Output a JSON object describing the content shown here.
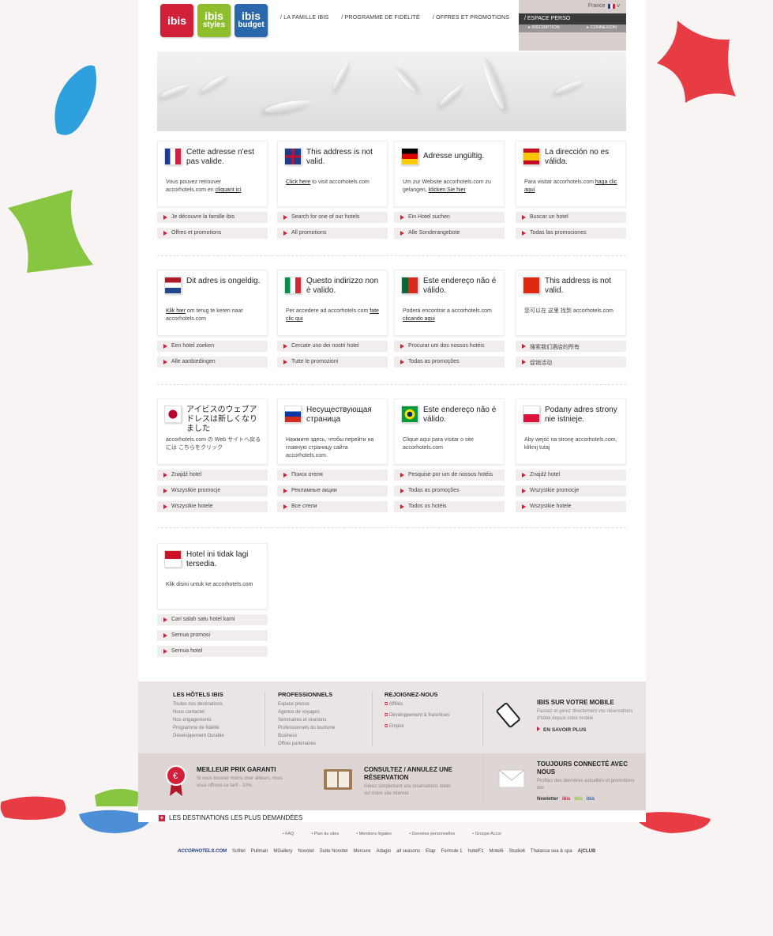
{
  "header": {
    "logos": [
      {
        "name": "ibis",
        "sub": "",
        "color": "#d3203a"
      },
      {
        "name": "ibis",
        "sub": "styles",
        "color": "#8fbe2d"
      },
      {
        "name": "ibis",
        "sub": "budget",
        "color": "#2a67ad"
      }
    ],
    "nav": [
      "/ LA FAMILLE IBIS",
      "/ PROGRAMME DE FIDÉLITÉ",
      "/ OFFRES ET PROMOTIONS"
    ],
    "lang": "France",
    "espace": "/ ESPACE PERSO",
    "inscription": "INSCRIPTION",
    "connexion": "CONNEXION"
  },
  "cards": [
    {
      "title": "Cette adresse n'est pas valide.",
      "msg": "Vous pouvez retrouver accorhotels.com en ",
      "msg_link": "cliquant ici",
      "links": [
        "Je découvre la famille ibis",
        "Offres et promotions"
      ],
      "flag": "fr"
    },
    {
      "title": "This address is not valid.",
      "msg_link_first": "Click here",
      "msg": " to visit accorhotels.com",
      "links": [
        "Search for one of our hotels",
        "All promotions"
      ],
      "flag": "uk"
    },
    {
      "title": "Adresse ungültig.",
      "msg": "Um zur Website accorhotels.com zu gelangen, ",
      "msg_link": "klicken Sie hier",
      "links": [
        "Ein Hotel suchen",
        "Alle Sonderangebote"
      ],
      "flag": "de"
    },
    {
      "title": "La dirección no es válida.",
      "msg": "Para visitar accorhotels.com ",
      "msg_link": "haga clic aquí",
      "links": [
        "Buscar un hotel",
        "Todas las promociones"
      ],
      "flag": "es"
    },
    {
      "title": "Dit adres is ongeldig.",
      "msg_link_first": "Klik hier",
      "msg": " om terug te keren naar accorhotels.com",
      "links": [
        "Een hotel zoeken",
        "Alle aanbiedingen"
      ],
      "flag": "nl"
    },
    {
      "title": "Questo indirizzo non è valido.",
      "msg": "Per accedere ad accorhotels.com ",
      "msg_link": "fate clic qui",
      "links": [
        "Cercate uno dei nostri hotel",
        "Tutte le promozioni"
      ],
      "flag": "it"
    },
    {
      "title": "Este endereço não é válido.",
      "msg": "Poderá encontrar a accorhotels.com ",
      "msg_link": "clicando aqui",
      "links": [
        "Procurar um dos nossos hotéis",
        "Todas as promoções"
      ],
      "flag": "pt"
    },
    {
      "title": "This address is not valid.",
      "msg": "您可以在 这里 找到 accorhotels.com",
      "msg_link": "",
      "links": [
        "搜索我们酒店的所有",
        "促销活动"
      ],
      "flag": "cn"
    },
    {
      "title": "アイビスのウェブアドレスは新しくなりました",
      "msg": "accorhotels.com の Web サイトへ戻るには こちらをクリック",
      "msg_link": "",
      "links": [
        "Znajdź hotel",
        "Wszystkie promocje",
        "Wszystkie hotele"
      ],
      "flag": "jp"
    },
    {
      "title": "Несуществующая страница",
      "msg": "Нажмите здесь, чтобы перейти на главную страницу сайта accorhotels.com.",
      "msg_link": "",
      "links": [
        "Поиск отеля",
        "Рекламные акции",
        "Все отели"
      ],
      "flag": "ru"
    },
    {
      "title": "Este endereço não é válido.",
      "msg": "Clique aqui para visitar o site accorhotels.com",
      "msg_link": "",
      "links": [
        "Pesquise por um de nossos hotéis",
        "Todas as promoções",
        "Todos os hotéis"
      ],
      "flag": "br"
    },
    {
      "title": "Podany adres strony nie istnieje.",
      "msg": "Aby wejść na stronę accorhotels.com, kliknij tutaj",
      "msg_link": "",
      "links": [
        "Znajdź hotel",
        "Wszystkie promocje",
        "Wszystkie hotele"
      ],
      "flag": "pl"
    },
    {
      "title": "Hotel ini tidak lagi tersedia.",
      "msg": "Klik disini untuk ke accorhotels.com",
      "msg_link": "",
      "links": [
        "Cari salah satu hotel kami",
        "Semua promosi",
        "Semua hotel"
      ],
      "flag": "id"
    }
  ],
  "footer": {
    "col1_title": "LES HÔTELS IBIS",
    "col1": [
      "Toutes nos destinations",
      "Nous contacter",
      "Nos engagements",
      "Programme de fidélité",
      "Développement Durable"
    ],
    "col2_title": "PROFESSIONNELS",
    "col2": [
      "Espace presse",
      "Agence de voyages",
      "Séminaires et réunions",
      "Professionnels du tourisme",
      "Business",
      "Offres partenaires"
    ],
    "col3_title": "REJOIGNEZ-NOUS",
    "col3": [
      "Affiliés",
      "Développement & franchises",
      "Emploi"
    ],
    "mobile_title": "IBIS SUR VOTRE MOBILE",
    "mobile_text": "Passez et gérez directement vos réservations d'hôtel depuis votre mobile",
    "mobile_link": "EN SAVOIR PLUS",
    "prix_title": "MEILLEUR PRIX GARANTI",
    "prix_text": "Si vous trouvez moins cher ailleurs, nous vous offrons ce tarif - 10%.",
    "consult_title": "CONSULTEZ / ANNULEZ UNE RÉSERVATION",
    "consult_text": "Gérez simplement vos réservations faites sur notre site internet.",
    "connect_title": "TOUJOURS CONNECTÉ AVEC NOUS",
    "connect_text": "Profitez des dernières actualités et promotions ibis",
    "newsletter": "Newletter",
    "dest": "LES DESTINATIONS LES PLUS DEMANDÉES",
    "legal": [
      "• FAQ",
      "• Plan du sites",
      "• Mentions légales",
      "• Données personnelles",
      "• Groupe Accor"
    ],
    "brands": [
      "ACCORHOTELS.COM",
      "Sofitel",
      "Pullman",
      "MGallery",
      "Novotel",
      "Suite Novotel",
      "Mercure",
      "Adagio",
      "all seasons",
      "Etap",
      "Formule 1",
      "hotelF1",
      "Motel6",
      "Studio6",
      "Thalassa sea & spa",
      "A|CLUB"
    ]
  }
}
